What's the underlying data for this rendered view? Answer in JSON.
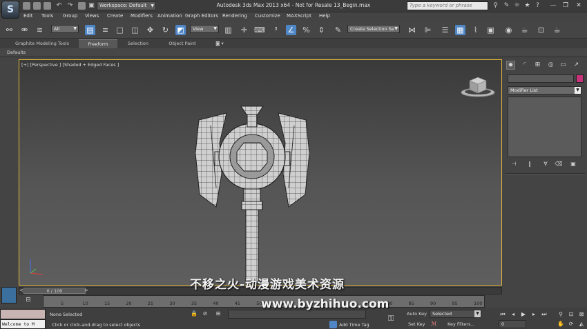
{
  "titlebar": {
    "workspace": "Workspace: Default",
    "window_title": "Autodesk 3ds Max  2013 x64  - Not for Resale   13_Begin.max",
    "search_placeholder": "Type a keyword or phrase"
  },
  "menu": [
    "Edit",
    "Tools",
    "Group",
    "Views",
    "Create",
    "Modifiers",
    "Animation",
    "Graph Editors",
    "Rendering",
    "Customize",
    "MAXScript",
    "Help"
  ],
  "toolbar": {
    "selection_filter": "All",
    "reference_coord": "View",
    "named_selection": "Create Selection Se"
  },
  "ribbon": {
    "tabs": [
      "Graphite Modeling Tools",
      "Freeform",
      "Selection",
      "Object Paint"
    ],
    "active_tab": "Freeform",
    "panel_label": "Defaults"
  },
  "viewport": {
    "label": "[+] [Perspective ] [Shaded + Edged Faces ]"
  },
  "command_panel": {
    "modifier_list": "Modifier List"
  },
  "timeline": {
    "slider_label": "0 / 100",
    "ticks": [
      "5",
      "10",
      "15",
      "20",
      "25",
      "30",
      "35",
      "40",
      "45",
      "50",
      "55",
      "60",
      "65",
      "70",
      "75",
      "80",
      "85",
      "90",
      "95",
      "100"
    ]
  },
  "status": {
    "maxscript_text": "Welcome to M",
    "selection": "None Selected",
    "prompt": "Click or click-and-drag to select objects",
    "add_time_tag": "Add Time Tag",
    "auto_key": "Auto Key",
    "set_key": "Set Key",
    "key_mode": "Selected",
    "key_filters": "Key Filters...",
    "frame": "0"
  },
  "watermark": {
    "cn": "不移之火-动漫游戏美术资源",
    "url": "www.byzhihuo.com"
  },
  "colors": {
    "accent": "#4f86c6",
    "viewport_border": "#e5b83a",
    "object_color": "#c8327b"
  }
}
